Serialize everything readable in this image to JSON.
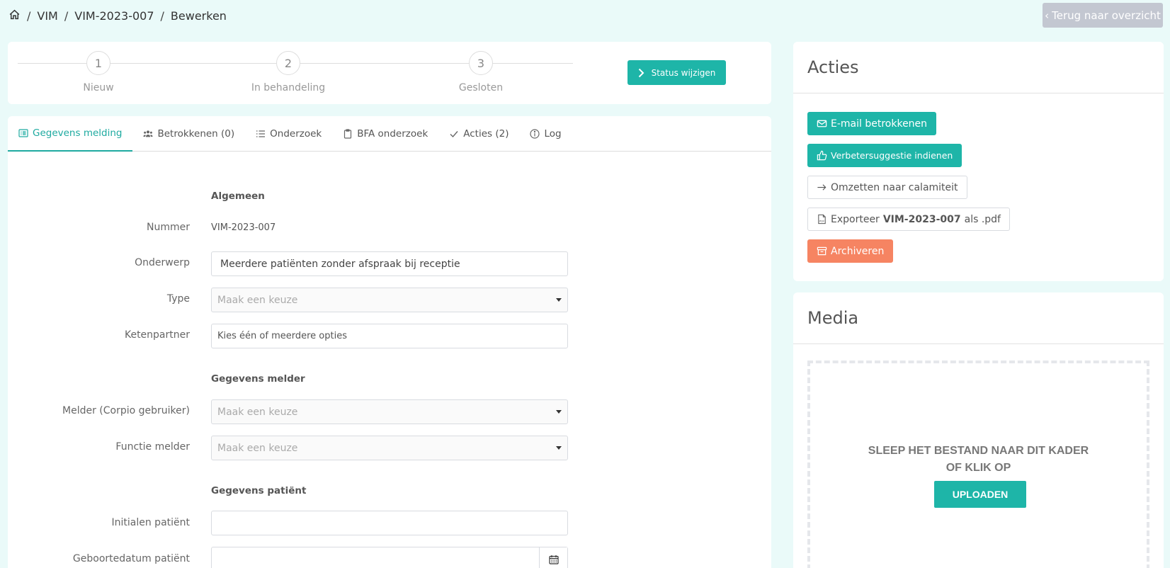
{
  "breadcrumb": {
    "items": [
      "VIM",
      "VIM-2023-007",
      "Bewerken"
    ]
  },
  "back_button": {
    "label": "Terug naar overzicht"
  },
  "stepper": {
    "steps": [
      {
        "number": "1",
        "label": "Nieuw"
      },
      {
        "number": "2",
        "label": "In behandeling"
      },
      {
        "number": "3",
        "label": "Gesloten"
      }
    ],
    "status_button": "Status wijzigen"
  },
  "tabs": [
    {
      "label": "Gegevens melding",
      "icon": "list-alt-icon",
      "active": true
    },
    {
      "label": "Betrokkenen (0)",
      "icon": "users-icon",
      "active": false
    },
    {
      "label": "Onderzoek",
      "icon": "list-icon",
      "active": false
    },
    {
      "label": "BFA onderzoek",
      "icon": "clipboard-icon",
      "active": false
    },
    {
      "label": "Acties (2)",
      "icon": "check-icon",
      "active": false
    },
    {
      "label": "Log",
      "icon": "info-icon",
      "active": false
    }
  ],
  "form": {
    "section_general": "Algemeen",
    "nummer": {
      "label": "Nummer",
      "value": "VIM-2023-007"
    },
    "onderwerp": {
      "label": "Onderwerp",
      "value": "Meerdere patiënten zonder afspraak bij receptie"
    },
    "type": {
      "label": "Type",
      "placeholder": "Maak een keuze"
    },
    "ketenpartner": {
      "label": "Ketenpartner",
      "placeholder": "Kies één of meerdere opties"
    },
    "section_melder": "Gegevens melder",
    "melder": {
      "label": "Melder (Corpio gebruiker)",
      "placeholder": "Maak een keuze"
    },
    "functie": {
      "label": "Functie melder",
      "placeholder": "Maak een keuze"
    },
    "section_patient": "Gegevens patiënt",
    "initialen": {
      "label": "Initialen patiënt",
      "value": ""
    },
    "geboortedatum": {
      "label": "Geboortedatum patiënt",
      "value": ""
    }
  },
  "acties": {
    "title": "Acties",
    "email_button": "E-mail betrokkenen",
    "suggestie_button": "Verbetersuggestie indienen",
    "omzetten_button": "Omzetten naar calamiteit",
    "export_prefix": "Exporteer",
    "export_code": "VIM-2023-007",
    "export_suffix": "als .pdf",
    "archive_button": "Archiveren"
  },
  "media": {
    "title": "Media",
    "drop_line1": "Sleep het bestand naar dit kader",
    "drop_line2": "of klik op",
    "upload_button": "Uploaden"
  },
  "colors": {
    "accent": "#1eb5a8",
    "archive": "#f68462",
    "background": "#eafaf9",
    "back_button": "#c3c7d1"
  }
}
